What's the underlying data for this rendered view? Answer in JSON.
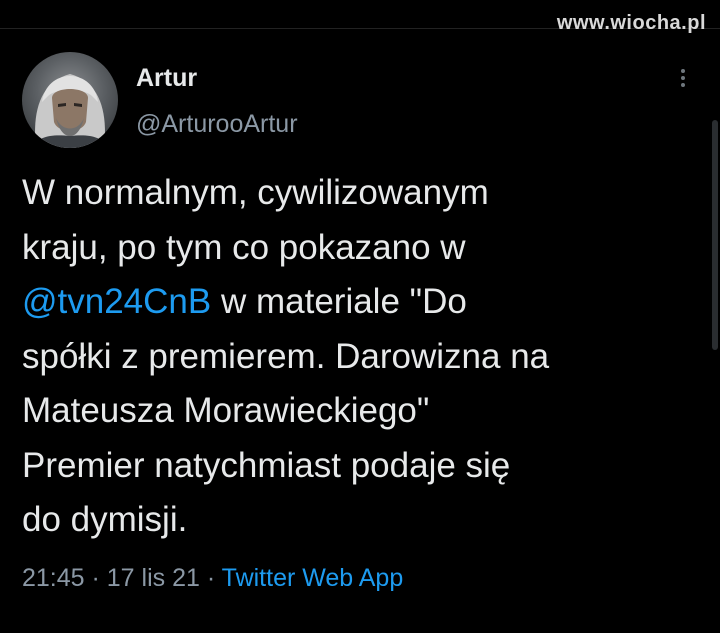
{
  "watermark": "www.wiocha.pl",
  "author": {
    "display_name": "Artur",
    "handle": "@ArturooArtur"
  },
  "tweet": {
    "line1": "W normalnym, cywilizowanym",
    "line2": "kraju, po tym co pokazano w",
    "line3_mention": "@tvn24CnB",
    "line3_rest": " w materiale \"Do",
    "line4": "spółki z premierem. Darowizna na",
    "line5": "Mateusza Morawieckiego\"",
    "line6": "Premier natychmiast podaje się",
    "line7": "do dymisji."
  },
  "meta": {
    "time": "21:45",
    "sep1": " · ",
    "date": "17 lis 21",
    "sep2": " · ",
    "source": "Twitter Web App"
  },
  "colors": {
    "background": "#000000",
    "text": "#e7e9ea",
    "secondary": "#8b98a5",
    "accent": "#1d9bf0"
  },
  "icons": {
    "more": "more-vertical-icon"
  }
}
